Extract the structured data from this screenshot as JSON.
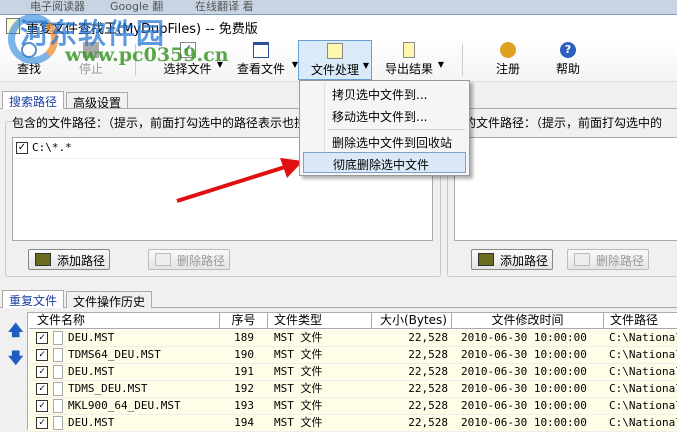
{
  "browser_strip": [
    "电子阅读器",
    "Google 翻",
    "在线翻译 看"
  ],
  "window": {
    "title": "重复文件查找王(MyDupFiles) -- 免费版"
  },
  "watermark": {
    "name": "河东软件园",
    "url": "www.pc0359.cn"
  },
  "toolbar": {
    "find": "查找",
    "stop": "停止",
    "select_files": "选择文件",
    "view_files": "查看文件",
    "file_process": "文件处理",
    "export": "导出结果",
    "register": "注册",
    "help": "帮助"
  },
  "file_menu": {
    "items": [
      "拷贝选中文件到...",
      "移动选中文件到...",
      "删除选中文件到回收站",
      "彻底删除选中文件"
    ]
  },
  "top_tabs": [
    "搜索路径",
    "高级设置"
  ],
  "include_group": {
    "label": "包含的文件路径：（提示，前面打勾选中的路径表示也搜",
    "paths": [
      "C:\\*.*"
    ],
    "add": "添加路径",
    "remove": "删除路径"
  },
  "exclude_group": {
    "label": "除的文件路径：（提示，前面打勾选中的",
    "add": "添加路径",
    "remove": "删除路径"
  },
  "bottom_tabs": [
    "重复文件",
    "文件操作历史"
  ],
  "table": {
    "columns": [
      "文件名称",
      "序号",
      "文件类型",
      "大小(Bytes)",
      "文件修改时间",
      "文件路径"
    ],
    "rows": [
      {
        "name": "DEU.MST",
        "no": "189",
        "type": "MST 文件",
        "size": "22,528",
        "time": "2010-06-30 10:00:00",
        "path": "C:\\National"
      },
      {
        "name": "TDMS64_DEU.MST",
        "no": "190",
        "type": "MST 文件",
        "size": "22,528",
        "time": "2010-06-30 10:00:00",
        "path": "C:\\National"
      },
      {
        "name": "DEU.MST",
        "no": "191",
        "type": "MST 文件",
        "size": "22,528",
        "time": "2010-06-30 10:00:00",
        "path": "C:\\National"
      },
      {
        "name": "TDMS_DEU.MST",
        "no": "192",
        "type": "MST 文件",
        "size": "22,528",
        "time": "2010-06-30 10:00:00",
        "path": "C:\\National"
      },
      {
        "name": "MKL900_64_DEU.MST",
        "no": "193",
        "type": "MST 文件",
        "size": "22,528",
        "time": "2010-06-30 10:00:00",
        "path": "C:\\National"
      },
      {
        "name": "DEU.MST",
        "no": "194",
        "type": "MST 文件",
        "size": "22,528",
        "time": "2010-06-30 10:00:00",
        "path": "C:\\National"
      }
    ]
  }
}
